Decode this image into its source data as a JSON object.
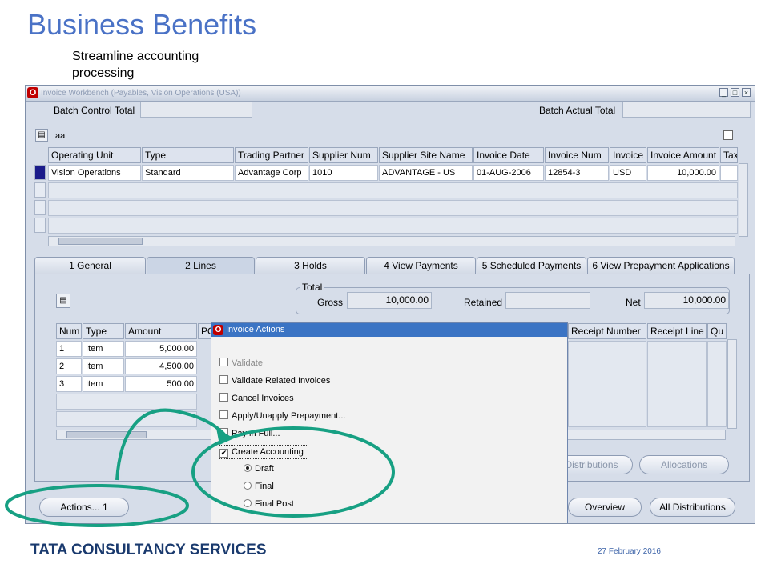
{
  "slide": {
    "title": "Business Benefits",
    "subtitle_line1": "Streamline accounting",
    "subtitle_line2": "processing"
  },
  "window": {
    "title": "Invoice Workbench (Payables, Vision Operations (USA))",
    "controls": {
      "minimize": "_",
      "maximize": "□",
      "close": "×"
    }
  },
  "batch": {
    "control_total_label": "Batch Control Total",
    "control_total_value": "",
    "actual_total_label": "Batch Actual Total",
    "actual_total_value": ""
  },
  "invoice_folder": {
    "folder_name": "aa",
    "columns": [
      "Operating Unit",
      "Type",
      "Trading Partner",
      "Supplier Num",
      "Supplier Site Name",
      "Invoice Date",
      "Invoice Num",
      "Invoice",
      "Invoice Amount",
      "Tax"
    ],
    "rows": [
      [
        "Vision Operations",
        "Standard",
        "Advantage Corp",
        "1010",
        "ADVANTAGE - US",
        "01-AUG-2006",
        "12854-3",
        "USD",
        "10,000.00",
        ""
      ]
    ]
  },
  "tabs": [
    {
      "num": "1",
      "label": " General"
    },
    {
      "num": "2",
      "label": " Lines"
    },
    {
      "num": "3",
      "label": " Holds"
    },
    {
      "num": "4",
      "label": " View Payments"
    },
    {
      "num": "5",
      "label": " Scheduled Payments"
    },
    {
      "num": "6",
      "label": " View Prepayment Applications"
    }
  ],
  "totals": {
    "group_label": "Total",
    "gross_label": "Gross",
    "gross_value": "10,000.00",
    "retained_label": "Retained",
    "retained_value": "",
    "net_label": "Net",
    "net_value": "10,000.00"
  },
  "lines": {
    "columns": [
      "Num",
      "Type",
      "Amount",
      "PO",
      "Receipt Number",
      "Receipt Line",
      "Qu"
    ],
    "rows": [
      [
        "1",
        "Item",
        "5,000.00"
      ],
      [
        "2",
        "Item",
        "4,500.00"
      ],
      [
        "3",
        "Item",
        "500.00"
      ]
    ]
  },
  "dialog": {
    "title": "Invoice Actions",
    "options": [
      {
        "label": "Validate",
        "checked": false,
        "enabled": false
      },
      {
        "label": "Validate Related Invoices",
        "checked": false,
        "enabled": true
      },
      {
        "label": "Cancel Invoices",
        "checked": false,
        "enabled": true
      },
      {
        "label": "Apply/Unapply Prepayment...",
        "checked": false,
        "enabled": true
      },
      {
        "label": "Pay in Full...",
        "checked": false,
        "enabled": true
      },
      {
        "label": "Create Accounting",
        "checked": true,
        "enabled": true
      }
    ],
    "accounting_modes": [
      {
        "label": "Draft",
        "selected": true
      },
      {
        "label": "Final",
        "selected": false
      },
      {
        "label": "Final Post",
        "selected": false
      }
    ]
  },
  "buttons": {
    "distributions": "Distributions",
    "allocations": "Allocations",
    "actions": "Actions... 1",
    "overview": "Overview",
    "all_distributions": "All Distributions"
  },
  "footer": {
    "company": "TATA CONSULTANCY SERVICES",
    "date": "27 February 2016"
  },
  "colors": {
    "title_blue": "#4a72c6",
    "annotation_green": "#17a083",
    "dialog_title_bar": "#3b74c4"
  }
}
